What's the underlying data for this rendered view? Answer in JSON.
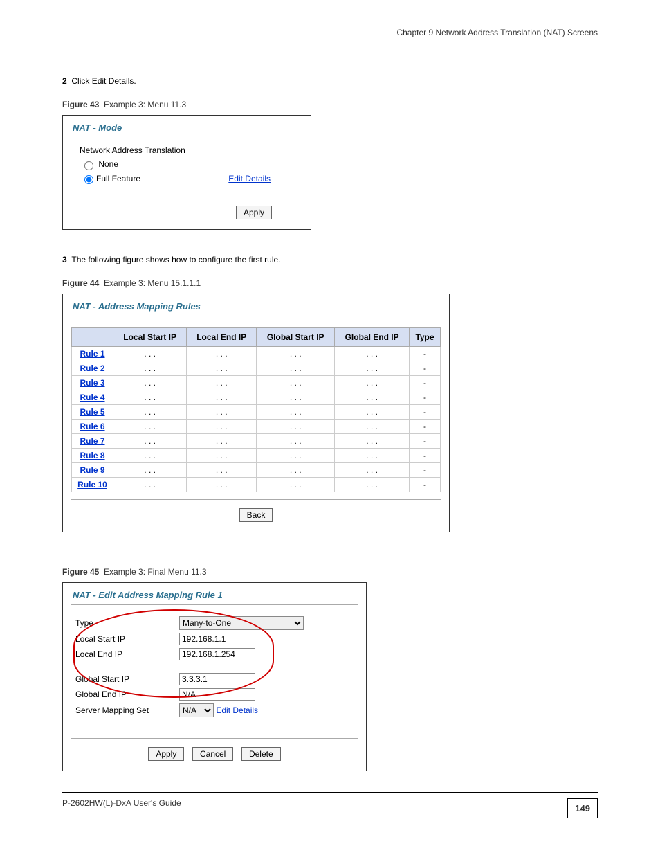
{
  "header": {
    "chapter": "Chapter 9 Network Address Translation (NAT) Screens"
  },
  "step2_text": "Click Edit Details.",
  "figure43": {
    "caption_label": "Figure 43",
    "caption_text": "Example 3: Menu 11.3",
    "title": "NAT - Mode",
    "heading": "Network Address Translation",
    "radio_none": "None",
    "radio_full": "Full Feature",
    "edit_details": "Edit Details",
    "apply": "Apply"
  },
  "step3_intro": "The following figure shows how to configure the first rule.",
  "figure44": {
    "caption_label": "Figure 44",
    "caption_text": "Example 3: Menu 15.1.1.1",
    "title": "NAT - Address Mapping Rules",
    "columns": [
      "",
      "Local Start IP",
      "Local End IP",
      "Global Start IP",
      "Global End IP",
      "Type"
    ],
    "rules": [
      {
        "name": "Rule 1",
        "lsip": ". . .",
        "leip": ". . .",
        "gsip": ". . .",
        "geip": ". . .",
        "type": "-"
      },
      {
        "name": "Rule 2",
        "lsip": ". . .",
        "leip": ". . .",
        "gsip": ". . .",
        "geip": ". . .",
        "type": "-"
      },
      {
        "name": "Rule 3",
        "lsip": ". . .",
        "leip": ". . .",
        "gsip": ". . .",
        "geip": ". . .",
        "type": "-"
      },
      {
        "name": "Rule 4",
        "lsip": ". . .",
        "leip": ". . .",
        "gsip": ". . .",
        "geip": ". . .",
        "type": "-"
      },
      {
        "name": "Rule 5",
        "lsip": ". . .",
        "leip": ". . .",
        "gsip": ". . .",
        "geip": ". . .",
        "type": "-"
      },
      {
        "name": "Rule 6",
        "lsip": ". . .",
        "leip": ". . .",
        "gsip": ". . .",
        "geip": ". . .",
        "type": "-"
      },
      {
        "name": "Rule 7",
        "lsip": ". . .",
        "leip": ". . .",
        "gsip": ". . .",
        "geip": ". . .",
        "type": "-"
      },
      {
        "name": "Rule 8",
        "lsip": ". . .",
        "leip": ". . .",
        "gsip": ". . .",
        "geip": ". . .",
        "type": "-"
      },
      {
        "name": "Rule 9",
        "lsip": ". . .",
        "leip": ". . .",
        "gsip": ". . .",
        "geip": ". . .",
        "type": "-"
      },
      {
        "name": "Rule 10",
        "lsip": ". . .",
        "leip": ". . .",
        "gsip": ". . .",
        "geip": ". . .",
        "type": "-"
      }
    ],
    "back": "Back"
  },
  "figure45": {
    "caption_label": "Figure 45",
    "caption_text": "Example 3: Final Menu 11.3",
    "title": "NAT - Edit Address Mapping Rule 1",
    "fields": {
      "type_label": "Type",
      "type_value": "Many-to-One",
      "lsip_label": "Local Start IP",
      "lsip_value": "192.168.1.1",
      "leip_label": "Local End IP",
      "leip_value": "192.168.1.254",
      "gsip_label": "Global Start IP",
      "gsip_value": "3.3.3.1",
      "geip_label": "Global End IP",
      "geip_value": "N/A",
      "sms_label": "Server Mapping Set",
      "sms_value": "N/A",
      "edit_details": "Edit Details"
    },
    "apply": "Apply",
    "cancel": "Cancel",
    "delete": "Delete"
  },
  "footer": {
    "manual": "P-2602HW(L)-DxA User's Guide",
    "page": "149"
  }
}
